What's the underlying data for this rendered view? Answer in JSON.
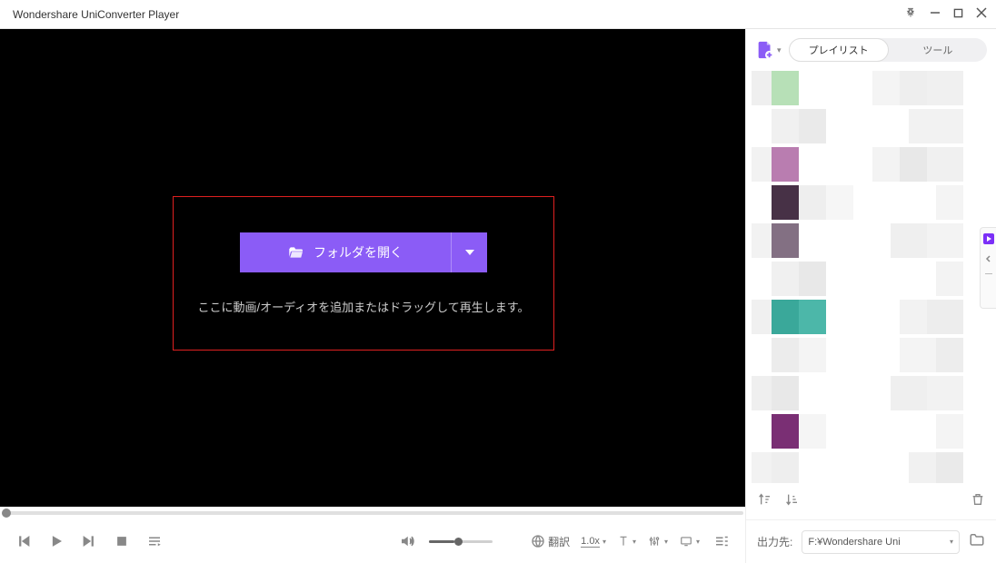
{
  "window": {
    "title": "Wondershare UniConverter Player"
  },
  "dropzone": {
    "open_folder_label": "フォルダを開く",
    "hint": "ここに動画/オーディオを追加またはドラッグして再生します。"
  },
  "controls": {
    "translate_label": "翻訳",
    "speed_label": "1.0x"
  },
  "sidebar": {
    "tabs": {
      "playlist": "プレイリスト",
      "tools": "ツール"
    },
    "output_label": "出力先:",
    "output_path": "F:¥Wondershare Uni"
  }
}
